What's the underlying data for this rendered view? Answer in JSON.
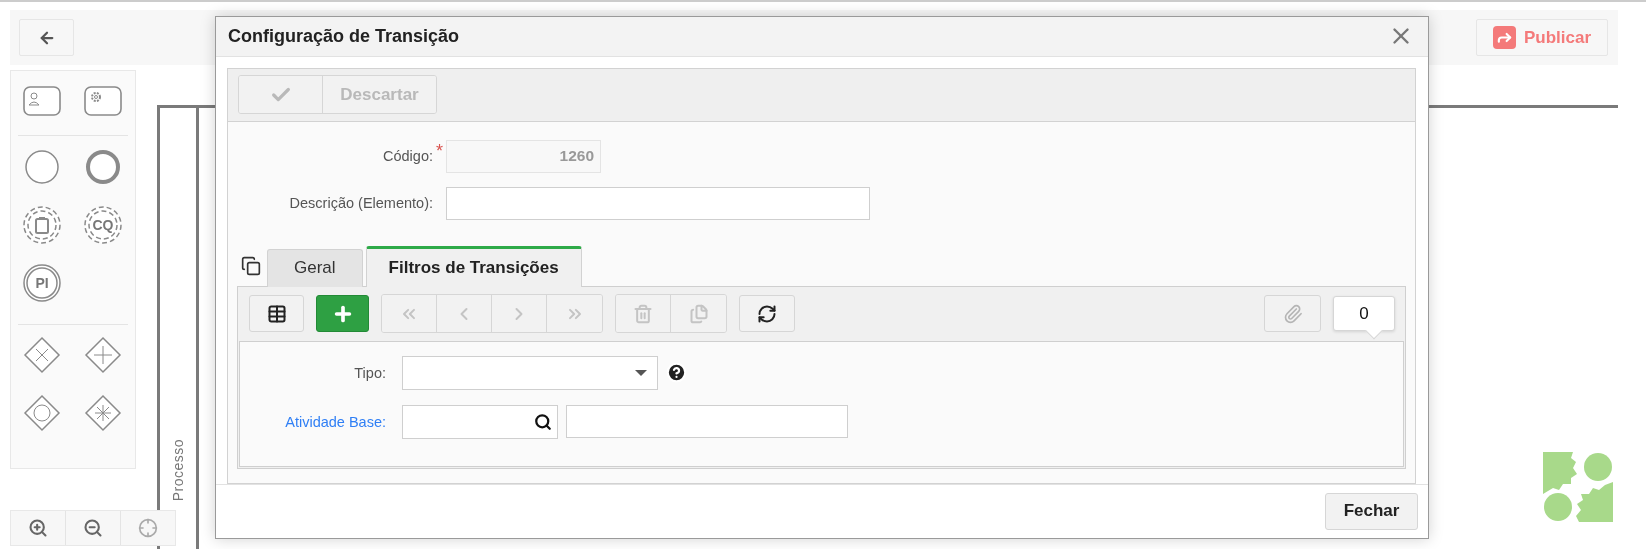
{
  "top_bar": {
    "publish_button": "Publicar"
  },
  "palette": {
    "groups": [
      [
        {
          "kind": "user-task"
        },
        {
          "kind": "service-task"
        }
      ],
      [
        {
          "kind": "start-event"
        },
        {
          "kind": "end-event"
        },
        {
          "kind": "clipboard-event"
        },
        {
          "kind": "letter-event",
          "label": "CQ"
        },
        {
          "kind": "letter-ring",
          "label": "PI"
        }
      ],
      [
        {
          "kind": "exclusive-gateway"
        },
        {
          "kind": "parallel-gateway"
        },
        {
          "kind": "inclusive-gateway"
        },
        {
          "kind": "complex-gateway"
        }
      ]
    ]
  },
  "canvas": {
    "pool_label": "Processo"
  },
  "dialog": {
    "title": "Configuração de Transição",
    "toolbar": {
      "discard_button": "Descartar",
      "disabled": true
    },
    "fields": [
      {
        "label": "Código:",
        "required_mark": "*",
        "value": "1260",
        "readonly": true
      },
      {
        "label": "Descrição (Elemento):",
        "readonly": false
      }
    ],
    "tabs": [
      {
        "label": "Geral",
        "selected": false
      },
      {
        "label": "Filtros de Transições",
        "selected": true
      }
    ],
    "grid_toolbar": {
      "buttons": [
        {
          "kind": "grid",
          "disabled": false
        },
        {
          "kind": "add",
          "disabled": false
        },
        {
          "kind": "first",
          "disabled": true
        },
        {
          "kind": "previous",
          "disabled": true
        },
        {
          "kind": "next",
          "disabled": true
        },
        {
          "kind": "last",
          "disabled": true
        },
        {
          "kind": "delete",
          "disabled": true
        },
        {
          "kind": "duplicate",
          "disabled": true
        },
        {
          "kind": "refresh",
          "disabled": false
        }
      ],
      "attach_disabled": true,
      "attachment_count": "0"
    },
    "filter_fields": [
      {
        "label": "Tipo:",
        "kind": "select",
        "link": false
      },
      {
        "label": "Atividade Base:",
        "kind": "lookup",
        "link": true
      }
    ],
    "close_button": "Fechar"
  }
}
